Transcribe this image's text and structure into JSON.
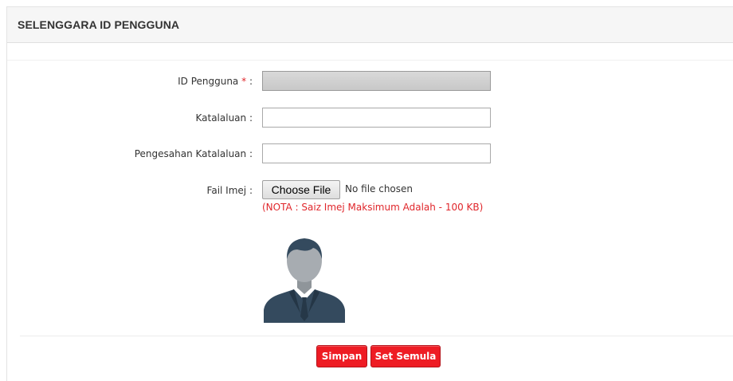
{
  "panel": {
    "title": "SELENGGARA ID PENGGUNA"
  },
  "form": {
    "user_id": {
      "label": "ID Pengguna",
      "required_mark": "*",
      "suffix": ":",
      "value": ""
    },
    "password": {
      "label": "Katalaluan :",
      "value": ""
    },
    "confirm_password": {
      "label": "Pengesahan Katalaluan :",
      "value": ""
    },
    "image": {
      "label": "Fail Imej :",
      "button_label": "Choose File",
      "status": "No file chosen",
      "note": "(NOTA : Saiz Imej Maksimum Adalah - 100 KB)"
    },
    "avatar_icon": "user-silhouette-icon"
  },
  "actions": {
    "save_label": "Simpan",
    "reset_label": "Set Semula"
  },
  "colors": {
    "accent_red": "#ee1c24",
    "note_red": "#e0262b",
    "avatar_gray": "#a7acb1",
    "suit_navy": "#344a5e"
  }
}
